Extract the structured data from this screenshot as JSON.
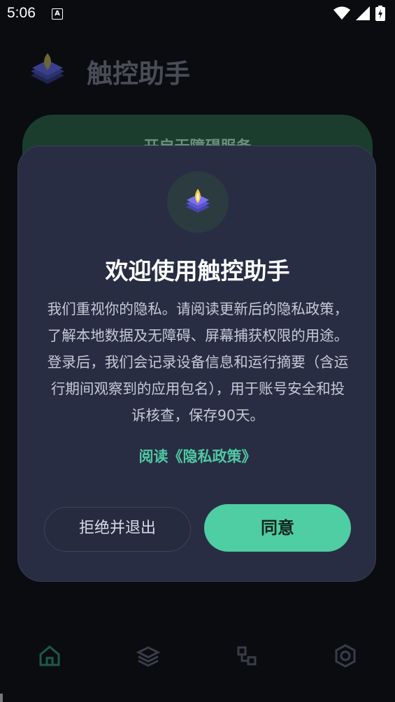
{
  "status_bar": {
    "time": "5:06",
    "notification_letter": "A"
  },
  "app": {
    "title": "触控助手",
    "card_label": "开启无障碍服务"
  },
  "dialog": {
    "title": "欢迎使用触控助手",
    "body": "我们重视你的隐私。请阅读更新后的隐私政策，了解本地数据及无障碍、屏幕捕获权限的用途。登录后，我们会记录设备信息和运行摘要（含运行期间观察到的应用包名），用于账号安全和投诉核查，保存90天。",
    "link": "阅读《隐私政策》",
    "decline_label": "拒绝并退出",
    "agree_label": "同意"
  },
  "bottom_nav": {
    "items": [
      {
        "icon": "home-icon",
        "active": true
      },
      {
        "icon": "layers-icon",
        "active": false
      },
      {
        "icon": "flow-icon",
        "active": false
      },
      {
        "icon": "settings-icon",
        "active": false
      }
    ]
  },
  "colors": {
    "accent": "#4fcda3",
    "dialog_bg": "#282d43",
    "background": "#0a0c10"
  }
}
